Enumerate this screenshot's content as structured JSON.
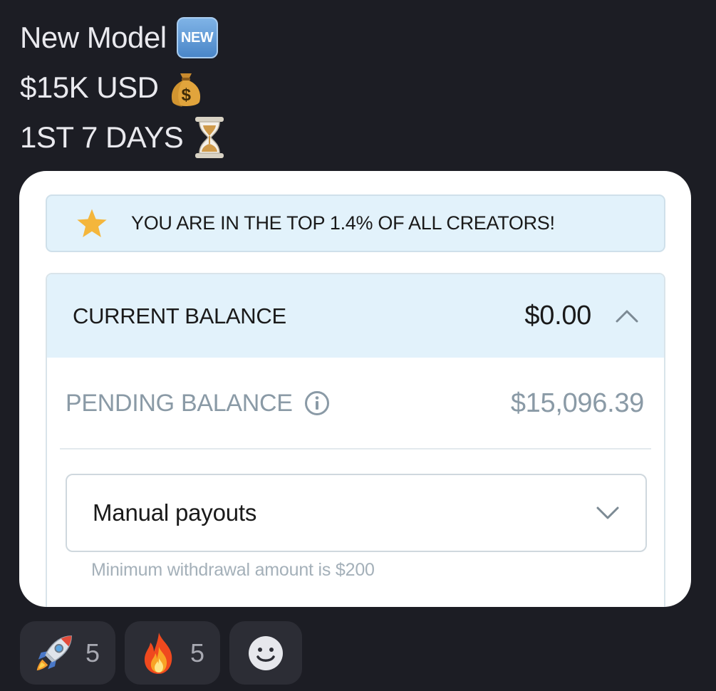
{
  "message": {
    "lines": [
      {
        "text": "New Model",
        "emoji": "new-badge-icon",
        "badge_text": "NEW"
      },
      {
        "text": "$15K USD",
        "emoji": "money-bag-icon",
        "bag_symbol": "$"
      },
      {
        "text": "1ST 7 DAYS",
        "emoji": "hourglass-icon"
      }
    ]
  },
  "card": {
    "banner": {
      "icon": "star-icon",
      "text": "YOU ARE IN THE TOP 1.4% OF ALL CREATORS!"
    },
    "current_balance": {
      "label": "CURRENT BALANCE",
      "amount": "$0.00",
      "toggle_icon": "chevron-up-icon"
    },
    "pending_balance": {
      "label": "PENDING BALANCE",
      "info_icon": "info-icon",
      "amount": "$15,096.39"
    },
    "payout_select": {
      "value": "Manual payouts",
      "icon": "chevron-down-icon"
    },
    "helper": "Minimum withdrawal amount is $200"
  },
  "reactions": [
    {
      "emoji": "rocket-icon",
      "count": "5"
    },
    {
      "emoji": "fire-icon",
      "count": "5"
    },
    {
      "emoji": "add-reaction-icon"
    }
  ],
  "colors": {
    "background": "#1c1d24",
    "banner_bg": "#e2f2fb",
    "muted_text": "#8a9aa6",
    "reaction_bg": "#2c2d35",
    "star": "#f4b63c"
  }
}
